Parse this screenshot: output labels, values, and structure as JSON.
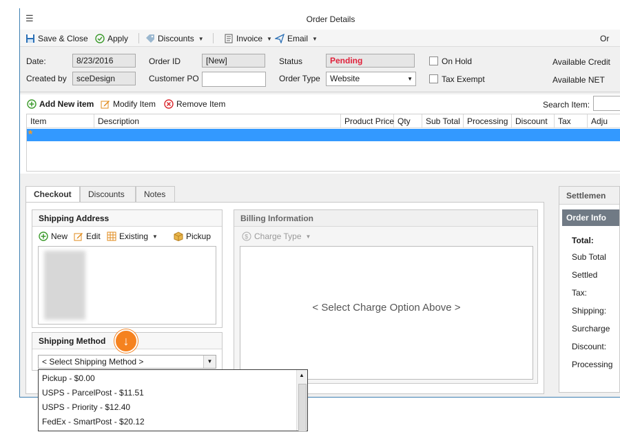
{
  "window": {
    "title": "Order Details"
  },
  "toolbar": {
    "save_close": "Save & Close",
    "apply": "Apply",
    "discounts": "Discounts",
    "invoice": "Invoice",
    "email": "Email",
    "right_cut": "Or"
  },
  "header": {
    "date_label": "Date:",
    "date_value": "8/23/2016",
    "created_by_label": "Created by",
    "created_by_value": "sceDesign",
    "order_id_label": "Order ID",
    "order_id_value": "[New]",
    "customer_po_label": "Customer PO",
    "customer_po_value": "",
    "status_label": "Status",
    "status_value": "Pending",
    "order_type_label": "Order Type",
    "order_type_value": "Website",
    "on_hold_label": "On Hold",
    "tax_exempt_label": "Tax Exempt",
    "available_credit_label": "Available Credit",
    "available_net_label": "Available NET",
    "status_color": "#e0203a"
  },
  "items": {
    "add_new_item": "Add New item",
    "modify_item": "Modify Item",
    "remove_item": "Remove Item",
    "search_label": "Search Item:",
    "columns": [
      "Item",
      "Description",
      "Product Price",
      "Qty",
      "Sub Total",
      "Processing",
      "Discount",
      "Tax",
      "Adju"
    ],
    "new_row_marker": "*"
  },
  "tabs": [
    "Checkout",
    "Discounts",
    "Notes"
  ],
  "shipping_address": {
    "title": "Shipping Address",
    "new": "New",
    "edit": "Edit",
    "existing": "Existing",
    "pickup": "Pickup"
  },
  "shipping_method": {
    "title": "Shipping Method",
    "selected": "< Select Shipping Method >",
    "options": [
      "Pickup - $0.00",
      "USPS - ParcelPost - $11.51",
      "USPS - Priority - $12.40",
      "FedEx - SmartPost - $20.12"
    ]
  },
  "billing": {
    "title": "Billing Information",
    "charge_type": "Charge Type",
    "placeholder": "< Select Charge Option Above >"
  },
  "settlement": {
    "tab_label": "Settlemen",
    "order_info": "Order Info",
    "total": "Total:",
    "sub_total": "Sub Total",
    "settled": "Settled",
    "tax": "Tax:",
    "shipping": "Shipping:",
    "surcharge": "Surcharge",
    "discount": "Discount:",
    "processing": "Processing"
  }
}
